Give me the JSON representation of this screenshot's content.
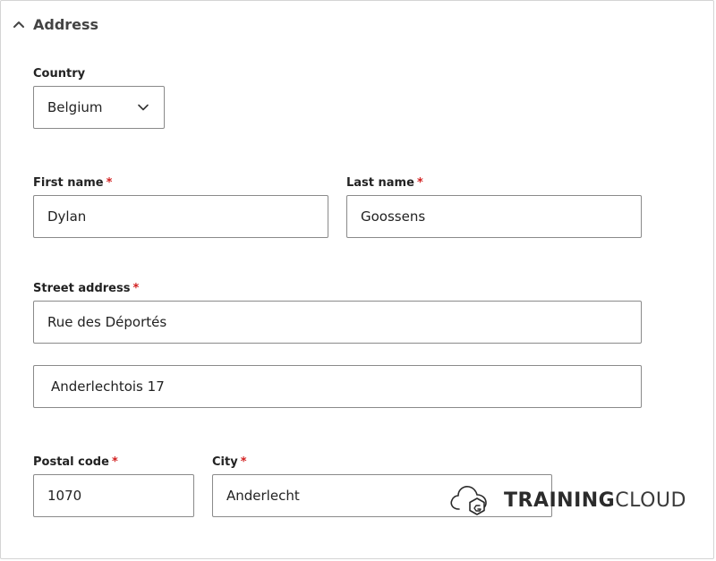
{
  "section": {
    "title": "Address"
  },
  "country": {
    "label": "Country",
    "value": "Belgium"
  },
  "first_name": {
    "label": "First name",
    "required_mark": "*",
    "value": "Dylan"
  },
  "last_name": {
    "label": "Last name",
    "required_mark": "*",
    "value": "Goossens"
  },
  "street": {
    "label": "Street address",
    "required_mark": "*",
    "line1": "Rue des Déportés",
    "line2": "Anderlechtois 17"
  },
  "postal_code": {
    "label": "Postal code",
    "required_mark": "*",
    "value": "1070"
  },
  "city": {
    "label": "City",
    "required_mark": "*",
    "value": "Anderlecht"
  },
  "watermark": {
    "brand_bold": "TRAINING",
    "brand_light": "CLOUD",
    "icon": "cloud-logo-icon"
  },
  "colors": {
    "required": "#d22020",
    "border": "#8a8a8a",
    "text": "#222222"
  }
}
